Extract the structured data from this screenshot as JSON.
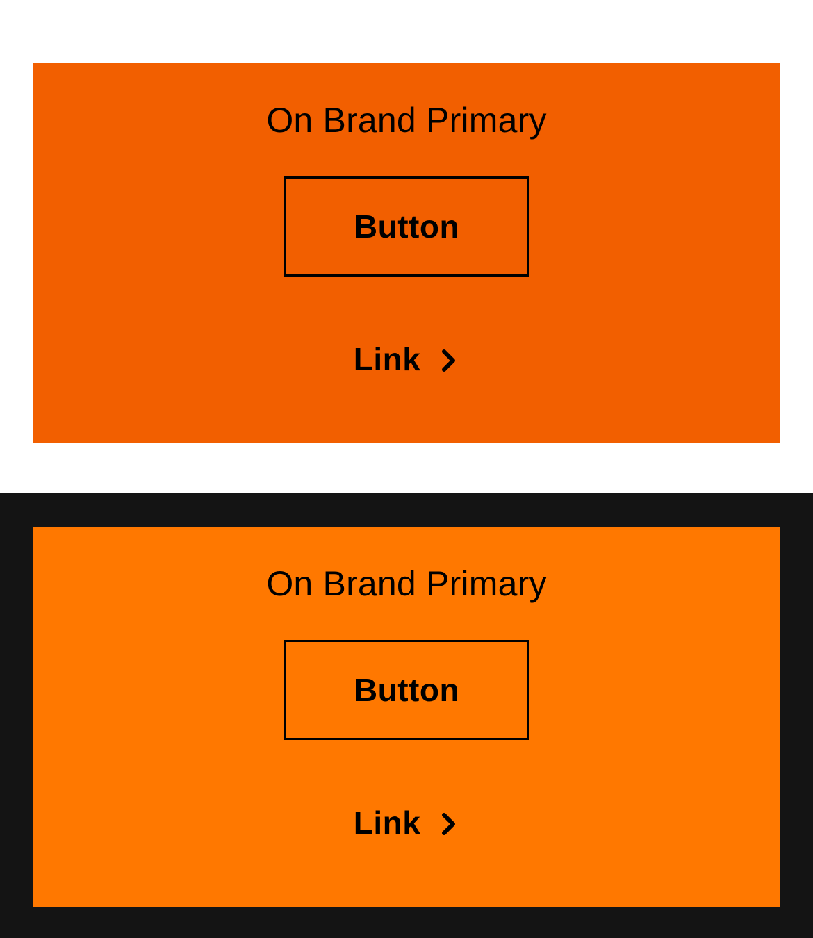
{
  "colors": {
    "light_background": "#ffffff",
    "dark_background": "#141414",
    "light_brand_primary": "#f25f00",
    "dark_brand_primary": "#ff7800",
    "on_brand_text": "#000000"
  },
  "light_card": {
    "title": "On Brand Primary",
    "button_label": "Button",
    "link_label": "Link",
    "link_icon": "chevron-right-icon"
  },
  "dark_card": {
    "title": "On Brand Primary",
    "button_label": "Button",
    "link_label": "Link",
    "link_icon": "chevron-right-icon"
  }
}
